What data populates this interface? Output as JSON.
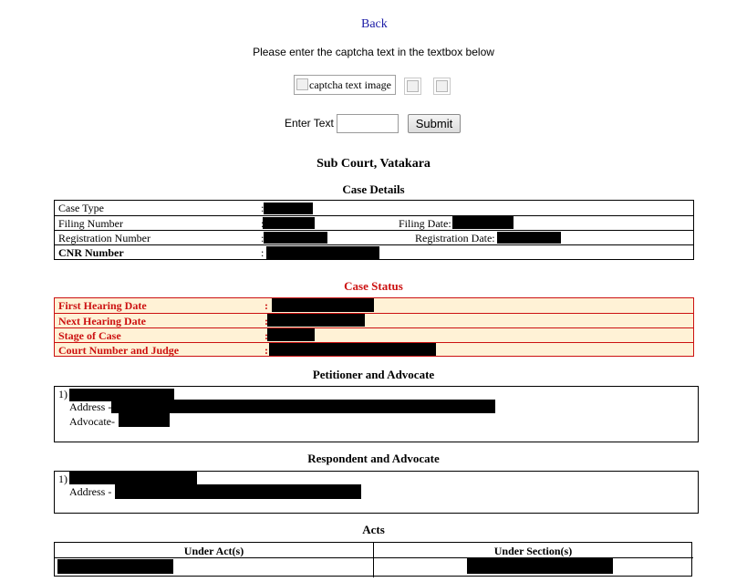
{
  "nav": {
    "back_label": "Back"
  },
  "captcha": {
    "prompt": "Please enter the captcha text in the textbox below",
    "image_alt": "captcha text image",
    "enter_text_label": "Enter Text",
    "input_value": "",
    "submit_label": "Submit"
  },
  "court": {
    "name": "Sub Court, Vatakara"
  },
  "case_details": {
    "heading": "Case Details",
    "case_type_label": "Case Type",
    "filing_number_label": "Filing Number",
    "filing_date_label": "Filing Date:",
    "registration_number_label": "Registration Number",
    "registration_date_label": "Registration Date:",
    "cnr_label": "CNR Number",
    "colon": ":"
  },
  "case_status": {
    "heading": "Case Status",
    "first_hearing_label": "First Hearing Date",
    "next_hearing_label": "Next Hearing Date",
    "stage_label": "Stage of Case",
    "court_judge_label": "Court Number and Judge",
    "colon": ":"
  },
  "petitioner": {
    "heading": "Petitioner and Advocate",
    "index": "1)",
    "address_label": "Address -",
    "advocate_label": "Advocate-"
  },
  "respondent": {
    "heading": "Respondent and Advocate",
    "index": "1)",
    "address_label": "Address -"
  },
  "acts": {
    "heading": "Acts",
    "col_act": "Under Act(s)",
    "col_section": "Under Section(s)"
  },
  "colors": {
    "link": "#1a1aa6",
    "status_red": "#cc1111",
    "status_bg": "#fff2d6"
  }
}
